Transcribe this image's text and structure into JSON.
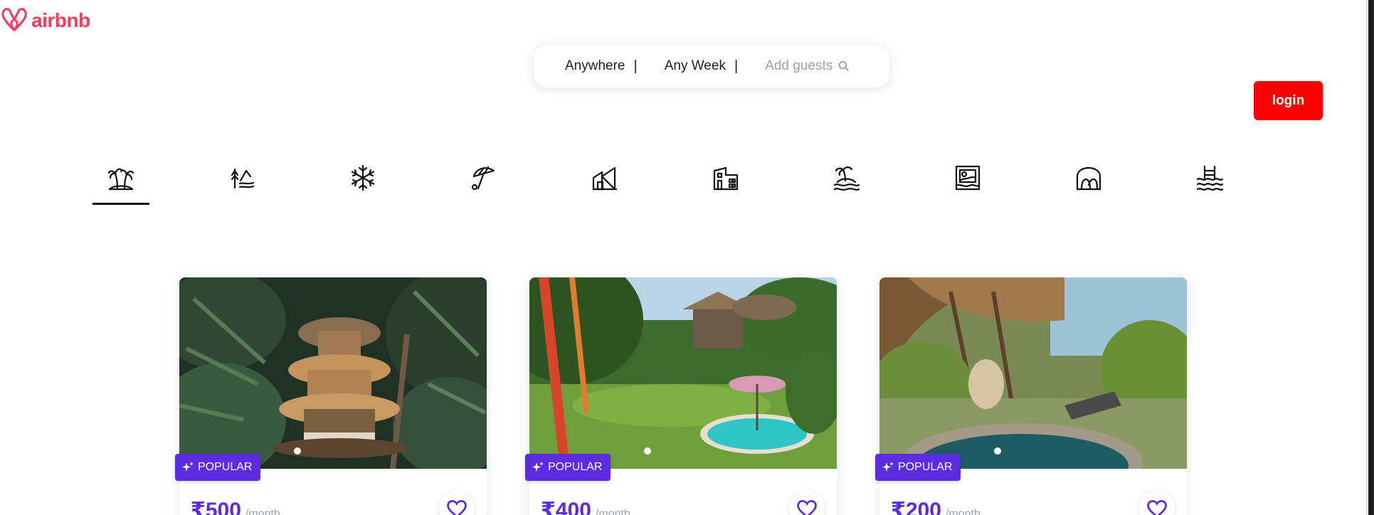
{
  "brand": {
    "name": "airbnb",
    "color": "#ff385c",
    "logo_icon": "airbnb-belo-icon"
  },
  "search": {
    "location": "Anywhere",
    "week": "Any Week",
    "separator": "|",
    "guests_placeholder": "Add guests",
    "search_icon": "search-icon"
  },
  "header": {
    "login_label": "login",
    "login_color": "#ff0000"
  },
  "categories": [
    {
      "icon": "palm-trees-icon",
      "active": true
    },
    {
      "icon": "lakefront-icon",
      "active": false
    },
    {
      "icon": "snowflake-icon",
      "active": false
    },
    {
      "icon": "beach-umbrella-icon",
      "active": false
    },
    {
      "icon": "house-icon",
      "active": false
    },
    {
      "icon": "townhouse-icon",
      "active": false
    },
    {
      "icon": "island-icon",
      "active": false
    },
    {
      "icon": "gallery-icon",
      "active": false
    },
    {
      "icon": "camping-icon",
      "active": false
    },
    {
      "icon": "pool-waves-icon",
      "active": false
    }
  ],
  "listings": [
    {
      "badge": "POPULAR",
      "price": "₹500",
      "unit": "/month",
      "image": "bamboo-treehouse-photo"
    },
    {
      "badge": "POPULAR",
      "price": "₹400",
      "unit": "/month",
      "image": "garden-villa-pool-photo"
    },
    {
      "badge": "POPULAR",
      "price": "₹200",
      "unit": "/month",
      "image": "bamboo-villa-pool-photo"
    }
  ],
  "colors": {
    "accent": "#5b2be0",
    "muted": "#9aa1ad"
  }
}
